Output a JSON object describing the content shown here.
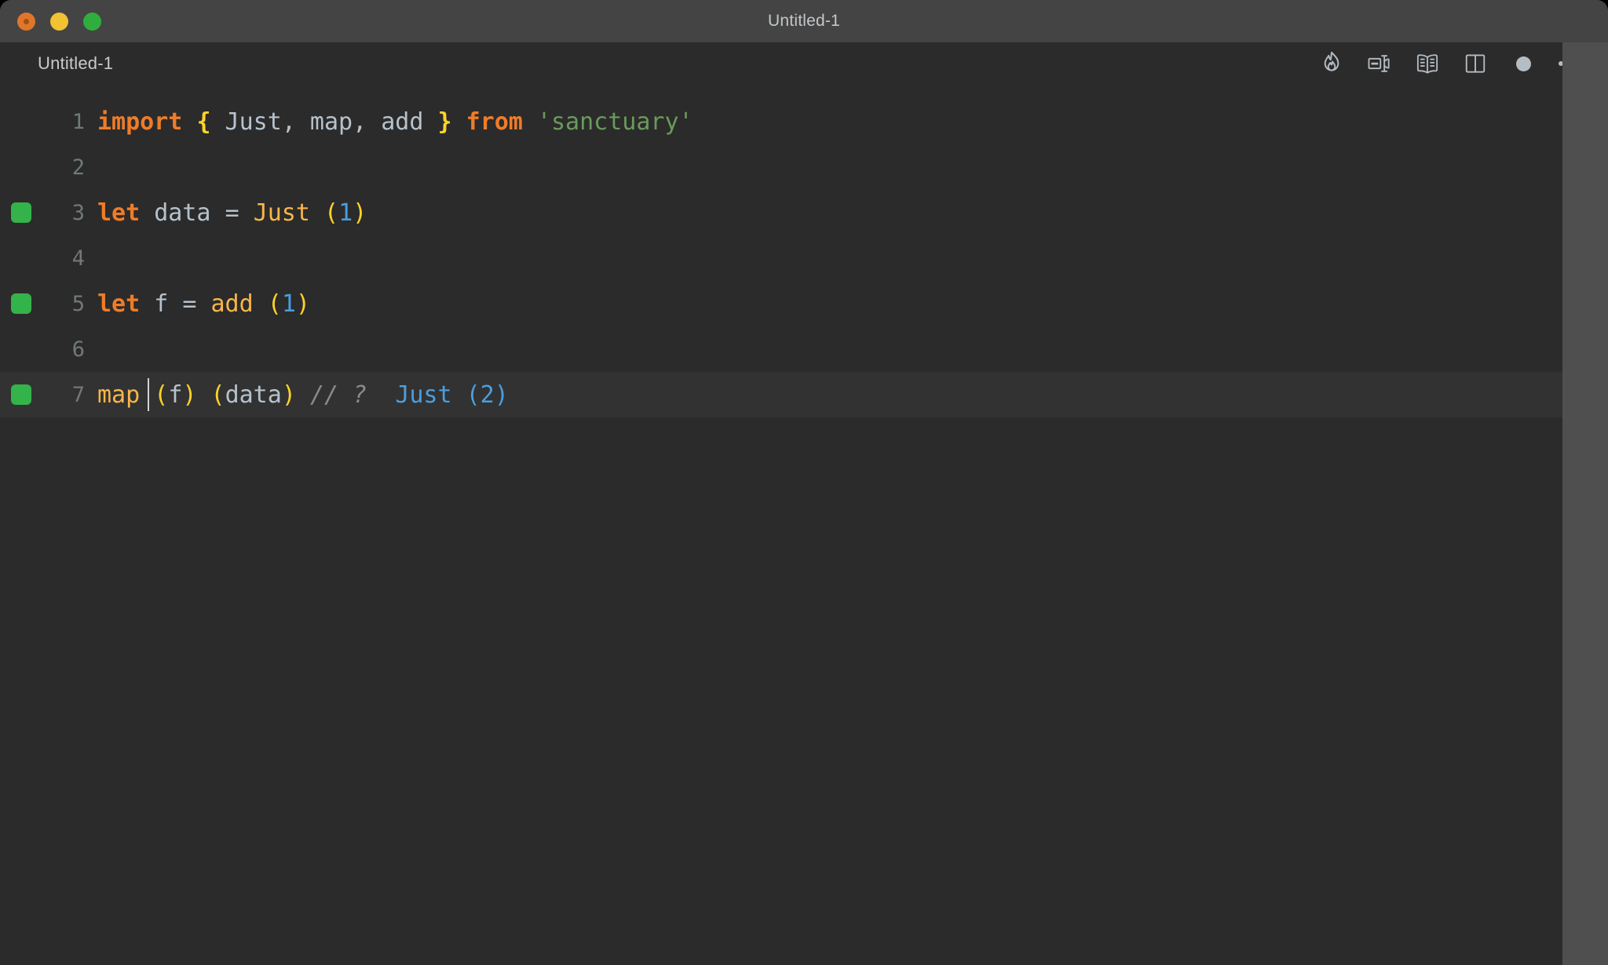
{
  "window": {
    "title": "Untitled-1",
    "controls": [
      {
        "name": "close",
        "color": "#e0762a"
      },
      {
        "name": "minimize",
        "color": "#f1c232"
      },
      {
        "name": "maximize",
        "color": "#2fae3e"
      }
    ]
  },
  "editor": {
    "tab_label": "Untitled-1",
    "actions": [
      {
        "name": "quokka-flame",
        "label": "Start Quokka"
      },
      {
        "name": "open-changes",
        "label": "Open Changes"
      },
      {
        "name": "open-preview",
        "label": "Open Preview"
      },
      {
        "name": "split-editor",
        "label": "Split Editor Right"
      },
      {
        "name": "unsaved-dot",
        "label": "Unsaved changes"
      },
      {
        "name": "more-actions",
        "label": "More Actions..."
      }
    ],
    "theme": {
      "background": "#2b2b2b",
      "active_line": "#323232",
      "chrome": "#4f4f4f",
      "titlebar": "#444444",
      "keyword": "#ef7c29",
      "function": "#f9b64a",
      "brace": "#ffd329",
      "number": "#4a9ede",
      "string": "#6a9a5b",
      "comment": "#8a8a8a",
      "identifier": "#b6c2cc",
      "line_number": "#707a72",
      "marker_green": "#33b34a",
      "result_blue": "#4a9ede"
    },
    "lines": [
      {
        "number": "1",
        "marker": false,
        "active": false,
        "tokens": [
          {
            "t": "import",
            "c": "kw"
          },
          {
            "t": " ",
            "c": "id"
          },
          {
            "t": "{",
            "c": "brace"
          },
          {
            "t": " Just",
            "c": "id"
          },
          {
            "t": ",",
            "c": "punct"
          },
          {
            "t": " map",
            "c": "id"
          },
          {
            "t": ",",
            "c": "punct"
          },
          {
            "t": " add ",
            "c": "id"
          },
          {
            "t": "}",
            "c": "brace"
          },
          {
            "t": " ",
            "c": "id"
          },
          {
            "t": "from",
            "c": "kw"
          },
          {
            "t": " ",
            "c": "id"
          },
          {
            "t": "'sanctuary'",
            "c": "str"
          }
        ]
      },
      {
        "number": "2",
        "marker": false,
        "active": false,
        "tokens": []
      },
      {
        "number": "3",
        "marker": true,
        "active": false,
        "tokens": [
          {
            "t": "let",
            "c": "kw"
          },
          {
            "t": " data ",
            "c": "id"
          },
          {
            "t": "=",
            "c": "punct"
          },
          {
            "t": " ",
            "c": "id"
          },
          {
            "t": "Just",
            "c": "func"
          },
          {
            "t": " ",
            "c": "id"
          },
          {
            "t": "(",
            "c": "paren"
          },
          {
            "t": "1",
            "c": "num"
          },
          {
            "t": ")",
            "c": "paren"
          }
        ]
      },
      {
        "number": "4",
        "marker": false,
        "active": false,
        "tokens": []
      },
      {
        "number": "5",
        "marker": true,
        "active": false,
        "tokens": [
          {
            "t": "let",
            "c": "kw"
          },
          {
            "t": " f ",
            "c": "id"
          },
          {
            "t": "=",
            "c": "punct"
          },
          {
            "t": " ",
            "c": "id"
          },
          {
            "t": "add",
            "c": "func"
          },
          {
            "t": " ",
            "c": "id"
          },
          {
            "t": "(",
            "c": "paren"
          },
          {
            "t": "1",
            "c": "num"
          },
          {
            "t": ")",
            "c": "paren"
          }
        ]
      },
      {
        "number": "6",
        "marker": false,
        "active": false,
        "tokens": []
      },
      {
        "number": "7",
        "marker": true,
        "active": true,
        "tokens": [
          {
            "t": "map",
            "c": "func"
          },
          {
            "t": " ",
            "c": "id"
          },
          {
            "t": "(",
            "c": "paren"
          },
          {
            "t": "f",
            "c": "id"
          },
          {
            "t": ")",
            "c": "paren"
          },
          {
            "t": " ",
            "c": "id"
          },
          {
            "t": "(",
            "c": "paren"
          },
          {
            "t": "data",
            "c": "id"
          },
          {
            "t": ")",
            "c": "paren"
          },
          {
            "t": " ",
            "c": "id"
          },
          {
            "t": "// ?",
            "c": "comment"
          },
          {
            "t": "  ",
            "c": "id"
          },
          {
            "t": "Just (2)",
            "c": "result"
          }
        ]
      }
    ]
  }
}
